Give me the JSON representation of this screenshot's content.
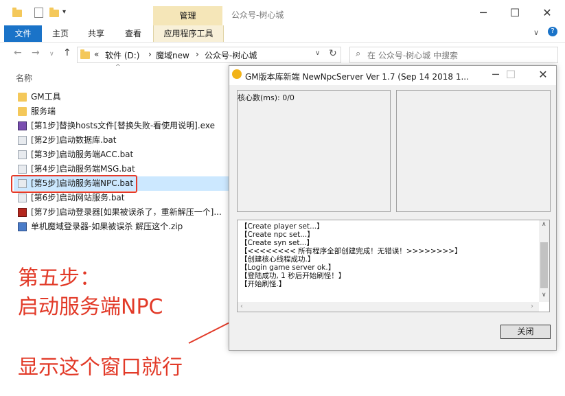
{
  "explorer": {
    "ctx_tab_label": "管理",
    "window_title": "公众号-树心城",
    "tabs": {
      "file": "文件",
      "home": "主页",
      "share": "共享",
      "view": "查看",
      "apptools": "应用程序工具"
    },
    "path": {
      "prefix": "«",
      "seg1": "软件 (D:)",
      "sep": "›",
      "seg2": "魔域new",
      "seg3": "公众号-树心城"
    },
    "search_placeholder": "在 公众号-树心城 中搜索",
    "column_name": "名称",
    "items": [
      {
        "name": "GM工具",
        "icon": "folder-icon"
      },
      {
        "name": "服务端",
        "icon": "folder-icon"
      },
      {
        "name": "[第1步]替换hosts文件[替换失败-看使用说明].exe",
        "icon": "exe-icon"
      },
      {
        "name": "[第2步]启动数据库.bat",
        "icon": "bat-icon"
      },
      {
        "name": "[第3步]启动服务端ACC.bat",
        "icon": "bat-icon"
      },
      {
        "name": "[第4步]启动服务端MSG.bat",
        "icon": "bat-icon"
      },
      {
        "name": "[第5步]启动服务端NPC.bat",
        "icon": "bat-icon"
      },
      {
        "name": "[第6步]启动网站服务.bat",
        "icon": "bat-icon"
      },
      {
        "name": "[第7步]启动登录器[如果被误杀了，重新解压一个]...",
        "icon": "game-icon"
      },
      {
        "name": "单机魔域登录器-如果被误杀 解压这个.zip",
        "icon": "zip-icon"
      }
    ]
  },
  "annotations": {
    "line1": "第五步：",
    "line2": "启动服务端NPC",
    "line3": "显示这个窗口就行"
  },
  "dialog": {
    "title": "GM版本库新端 NewNpcServer Ver 1.7 (Sep 14 2018 1...",
    "core_count": "核心数(ms): 0/0",
    "log": [
      "【Create player set...】",
      "【Create npc set...】",
      "【Create syn set...】",
      "【<<<<<<<< 所有程序全部创建完成！无错误！>>>>>>>>】",
      "【创建核心线程成功.】",
      "【Login game server ok.】",
      "【登陆成功, 1 秒后开始刷怪！】",
      "【开始刷怪.】"
    ],
    "close_label": "关闭"
  },
  "colors": {
    "accent": "#1a73c8",
    "annotation": "#e23a28",
    "selection": "#cce8ff"
  }
}
